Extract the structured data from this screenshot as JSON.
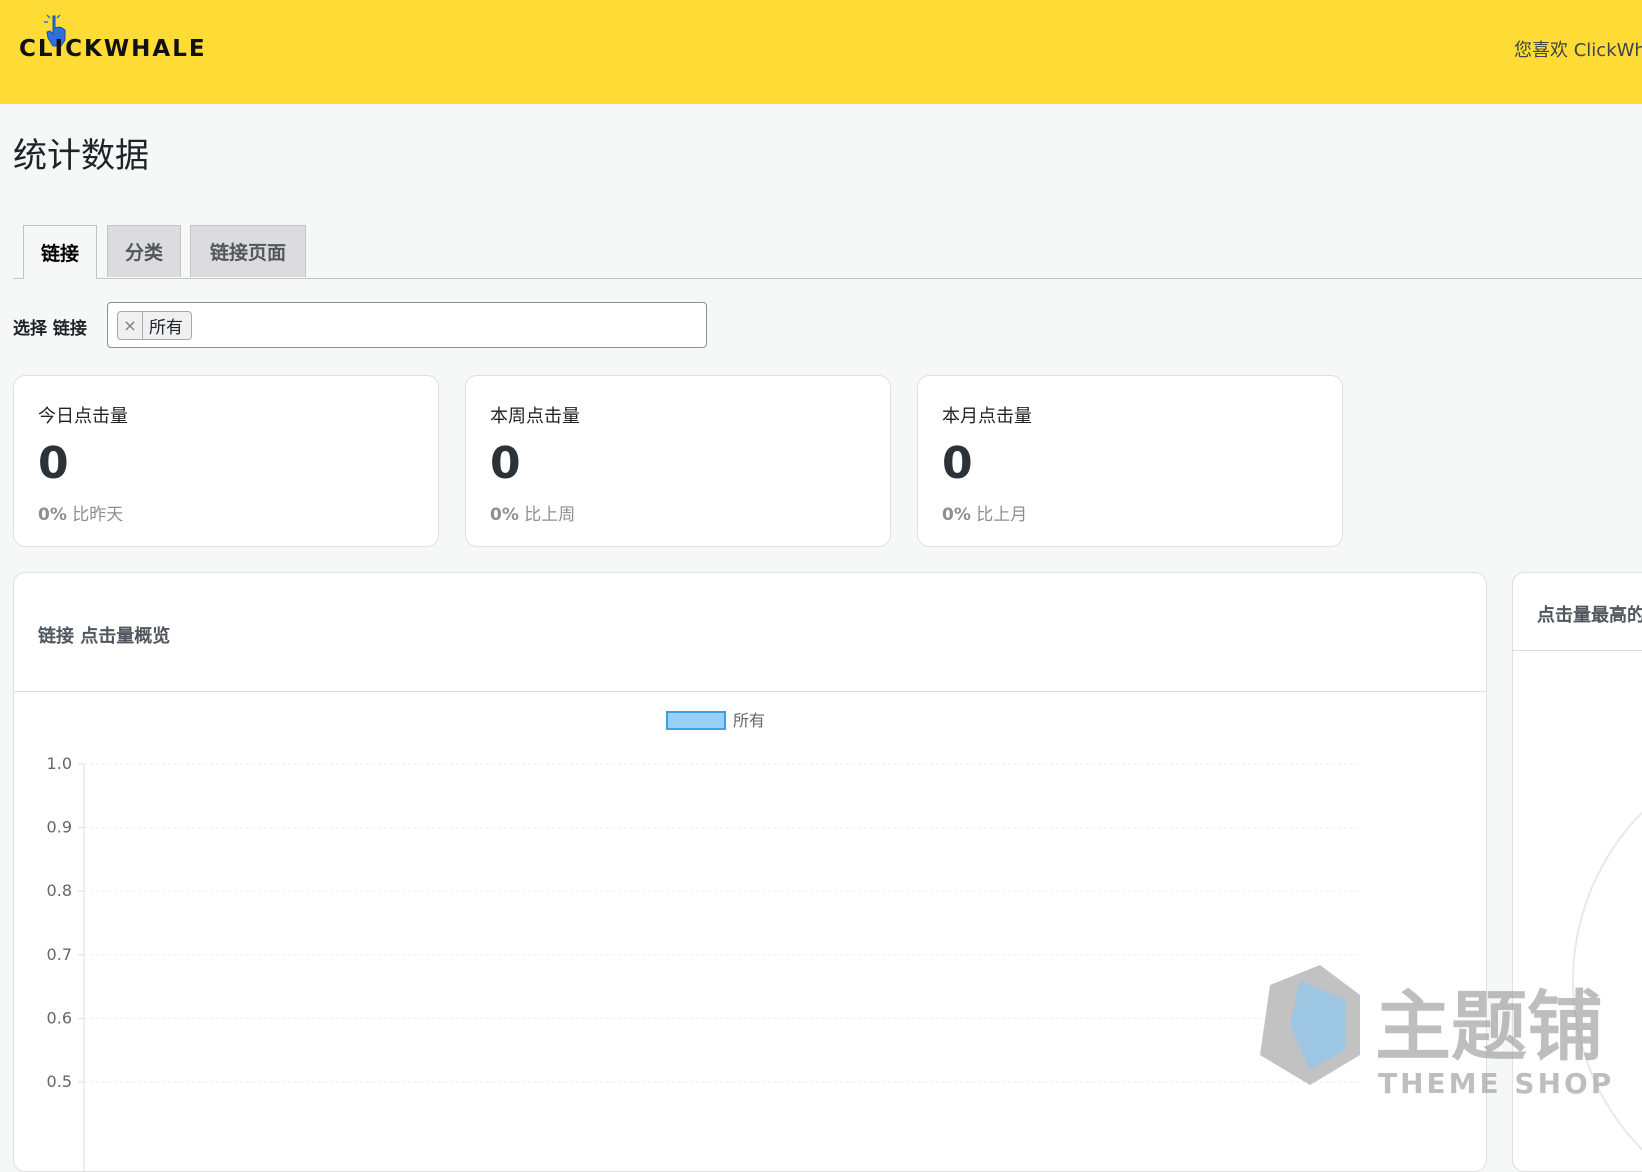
{
  "header": {
    "logo_text": "CLICKWHALE",
    "right_text": "您喜欢 ClickWh"
  },
  "page": {
    "title": "统计数据"
  },
  "tabs": [
    {
      "label": "链接",
      "active": true
    },
    {
      "label": "分类",
      "active": false
    },
    {
      "label": "链接页面",
      "active": false
    }
  ],
  "filter": {
    "label": "选择 链接",
    "remove_symbol": "×",
    "selected": "所有"
  },
  "stats": [
    {
      "label": "今日点击量",
      "value": "0",
      "change_pct": "0%",
      "change_text": "比昨天"
    },
    {
      "label": "本周点击量",
      "value": "0",
      "change_pct": "0%",
      "change_text": "比上周"
    },
    {
      "label": "本月点击量",
      "value": "0",
      "change_pct": "0%",
      "change_text": "比上月"
    }
  ],
  "chart_card": {
    "title": "链接 点击量概览"
  },
  "side_card": {
    "title": "点击量最高的"
  },
  "watermark": {
    "text_cn": "主题铺",
    "text_en": "THEME SHOP"
  },
  "colors": {
    "header_bg": "#ffdb35",
    "legend_fill": "#9ad0f5",
    "legend_stroke": "#36a2eb"
  },
  "chart_data": {
    "type": "line",
    "series": [
      {
        "name": "所有",
        "values": []
      }
    ],
    "y_ticks": [
      "1.0",
      "0.9",
      "0.8",
      "0.7",
      "0.6",
      "0.5"
    ],
    "ylim": [
      0.5,
      1.0
    ],
    "legend_position": "top-center",
    "grid": true
  }
}
